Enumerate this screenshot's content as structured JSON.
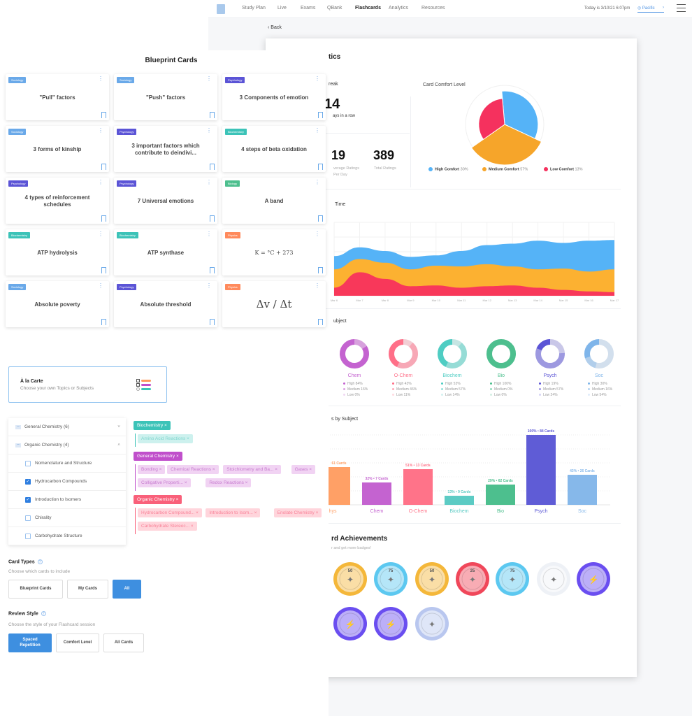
{
  "nav": {
    "items": [
      "Study Plan",
      "Live",
      "Exams",
      "QBank",
      "Flashcards",
      "Analytics",
      "Resources"
    ],
    "active": "Flashcards",
    "date": "Today is 3/10/21 6:07pm",
    "timezone": "Pacific",
    "back": "Back"
  },
  "analytics": {
    "title": "tics",
    "streak_title": "reak",
    "streak_value": "14",
    "streak_caption": "ays in a row",
    "avg_value": "19",
    "avg_caption_1": "verage Ratings",
    "avg_caption_2": "Per Day",
    "total_value": "389",
    "total_caption": "Total Ratings",
    "time_title": "Time",
    "subject_title": "ubject",
    "bars_title": "s by Subject",
    "achievements_title": "rd Achievements",
    "achievements_sub": "r and get more badges!",
    "badges": [
      {
        "num": "50",
        "color": "#f4b73a"
      },
      {
        "num": "75",
        "color": "#5cc8f0"
      },
      {
        "num": "50",
        "color": "#f4b73a"
      },
      {
        "num": "25",
        "color": "#f0475a"
      },
      {
        "num": "75",
        "color": "#5cc8f0"
      },
      {
        "num": "",
        "color": "#eef1f6"
      },
      {
        "num": "",
        "color": "#6a4ef0"
      },
      {
        "num": "",
        "color": "#6a4ef0"
      },
      {
        "num": "",
        "color": "#6a4ef0"
      },
      {
        "num": "",
        "color": "#b9c7ef"
      }
    ]
  },
  "chart_data": [
    {
      "type": "pie",
      "title": "Card Comfort Level",
      "slices": [
        {
          "name": "High Comfort",
          "label": "30%",
          "value": 30,
          "color": "#55b3f7"
        },
        {
          "name": "Medium Comfort",
          "label": "57%",
          "value": 57,
          "color": "#f6a52a"
        },
        {
          "name": "Low Comfort",
          "label": "13%",
          "value": 13,
          "color": "#f5315e"
        }
      ]
    },
    {
      "type": "area",
      "stacked": true,
      "x": [
        "Mar 6",
        "Mar 7",
        "Mar 8",
        "Mar 9",
        "Mar 10",
        "Mar 11",
        "Mar 12",
        "Mar 13",
        "Mar 14",
        "Mar 15",
        "Mar 16",
        "Mar 17"
      ],
      "ylim": [
        0,
        100
      ],
      "grid": true,
      "series": [
        {
          "color": "#f8385a",
          "values": [
            11,
            32,
            23,
            13,
            14,
            11,
            13,
            14,
            11,
            8,
            6,
            5
          ]
        },
        {
          "color": "#fcb131",
          "values": [
            25,
            18,
            22,
            23,
            27,
            29,
            30,
            26,
            25,
            29,
            27,
            31
          ]
        },
        {
          "color": "#55b3f7",
          "values": [
            18,
            16,
            16,
            17,
            14,
            21,
            26,
            31,
            39,
            35,
            42,
            40
          ]
        }
      ]
    },
    {
      "type": "donut",
      "subjects": [
        {
          "name": "",
          "color": "#ff9a5c",
          "values": [
            15,
            35,
            50
          ],
          "labels": []
        },
        {
          "name": "Chem",
          "color": "#c463d0",
          "values": [
            0,
            16,
            84
          ],
          "labels": [
            "High 84%",
            "Medium 16%",
            "Low 0%"
          ]
        },
        {
          "name": "O-Chem",
          "color": "#ff6f88",
          "values": [
            11,
            46,
            43
          ],
          "labels": [
            "High 43%",
            "Medium 46%",
            "Low 11%"
          ]
        },
        {
          "name": "Biochem",
          "color": "#4fcdc3",
          "values": [
            14,
            57,
            53
          ],
          "labels": [
            "High 53%",
            "Medium 57%",
            "Low 14%"
          ]
        },
        {
          "name": "Bio",
          "color": "#4dbf8e",
          "values": [
            0,
            0,
            100
          ],
          "labels": [
            "High 100%",
            "Medium 0%",
            "Low 0%"
          ]
        },
        {
          "name": "Psych",
          "color": "#5b54d6",
          "values": [
            24,
            57,
            19
          ],
          "labels": [
            "High 19%",
            "Medium 57%",
            "Low 24%"
          ]
        },
        {
          "name": "Soc",
          "color": "#7fb5ea",
          "values": [
            54,
            16,
            30
          ],
          "labels": [
            "High 30%",
            "Medium 16%",
            "Low 54%"
          ]
        }
      ]
    },
    {
      "type": "bar",
      "ylim": [
        0,
        100
      ],
      "categories": [
        "hys",
        "Chem",
        "O-Chem",
        "Biochem",
        "Bio",
        "Psych",
        "Soc"
      ],
      "values": [
        54,
        32,
        51,
        13,
        29,
        100,
        43
      ],
      "labels": [
        "61 Cards",
        "32% • 7 Cards",
        "51% • 13 Cards",
        "13% • 9 Cards",
        "29% • 62 Cards",
        "100% • 84 Cards",
        "43% • 26 Cards"
      ],
      "colors": [
        "#ffa066",
        "#c463d0",
        "#ff7389",
        "#5ccbc4",
        "#4dbf8e",
        "#5f5cd6",
        "#86b8ea"
      ]
    }
  ],
  "blueprint": {
    "title": "Blueprint Cards",
    "cards": [
      {
        "tag": "Sociology",
        "title": "\"Pull\" factors"
      },
      {
        "tag": "Sociology",
        "title": "\"Push\" factors"
      },
      {
        "tag": "Psychology",
        "title": "3 Components of emotion"
      },
      {
        "tag": "Sociology",
        "title": "3 forms of kinship"
      },
      {
        "tag": "Psychology",
        "title": "3 important factors which contribute to deindivi..."
      },
      {
        "tag": "Biochemistry",
        "title": "4 steps of beta oxidation"
      },
      {
        "tag": "Psychology",
        "title": "4 types of reinforcement schedules"
      },
      {
        "tag": "Psychology",
        "title": "7 Universal emotions"
      },
      {
        "tag": "Biology",
        "title": "A band"
      },
      {
        "tag": "Biochemistry",
        "title": "ATP hydrolysis"
      },
      {
        "tag": "Biochemistry",
        "title": "ATP synthase"
      },
      {
        "tag": "Physics",
        "title": "K = °C + 273"
      },
      {
        "tag": "Sociology",
        "title": "Absolute poverty"
      },
      {
        "tag": "Psychology",
        "title": "Absolute threshold"
      },
      {
        "tag": "Physics",
        "title": "Δv / Δt"
      }
    ],
    "tag_colors": {
      "Sociology": "#6aa9e9",
      "Psychology": "#5b54d6",
      "Biochemistry": "#3cc3b8",
      "Biology": "#4dbf8e",
      "Physics": "#ff8a5c"
    }
  },
  "filters": {
    "alacarte_title": "À la Carte",
    "alacarte_sub": "Choose your own Topics or Subjects",
    "tree": [
      {
        "label": "General Chemistry (6)",
        "type": "group",
        "open": false
      },
      {
        "label": "Organic Chemistry (4)",
        "type": "group",
        "open": true
      },
      {
        "label": "Nomenclature and Structure",
        "checked": false
      },
      {
        "label": "Hydrocarbon Compounds",
        "checked": true
      },
      {
        "label": "Introduction to Isomers",
        "checked": true
      },
      {
        "label": "Chirality",
        "checked": false
      },
      {
        "label": "Carbohydrate Structure",
        "checked": false
      }
    ],
    "groups": [
      {
        "name": "Biochemistry",
        "color": "#3cc3b8",
        "light": "#cdf1ee",
        "text": "#7fd6cf",
        "items": [
          "Amino Acid Reactions"
        ]
      },
      {
        "name": "General Chemistry",
        "color": "#c04fcb",
        "light": "#f1d3f3",
        "text": "#c77ccf",
        "items": [
          "Bonding",
          "Chemical Reactions",
          "Stoichiometry and Ba...",
          "Gases",
          "Colligative Properti...",
          "Redox Reactions"
        ]
      },
      {
        "name": "Organic Chemistry",
        "color": "#f9607a",
        "light": "#ffd5dc",
        "text": "#f98197",
        "items": [
          "Hydrocarbon Compound...",
          "Introduction to Isom...",
          "Enolate Chemistry",
          "Carbohydrate Stereoc..."
        ]
      }
    ],
    "card_types_title": "Card Types",
    "card_types_sub": "Choose which cards to include",
    "card_types": [
      "Blueprint Cards",
      "My Cards",
      "All"
    ],
    "card_types_selected": "All",
    "review_title": "Review Style",
    "review_sub": "Choose the style of your Flashcard session",
    "review_options": [
      "Spaced Repetition",
      "Comfort Level",
      "All Cards"
    ],
    "review_selected": "Spaced Repetition"
  }
}
